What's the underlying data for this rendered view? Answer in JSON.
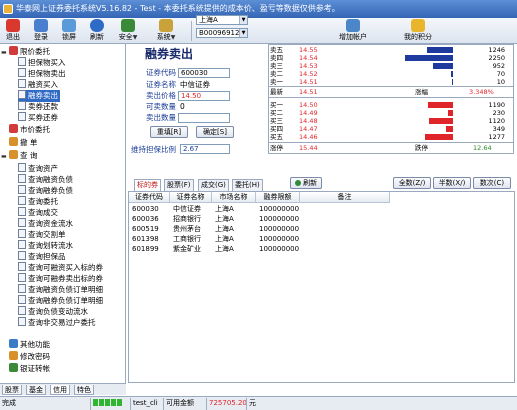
{
  "window": {
    "title": "华泰网上证券委托系统V5.16.82 - Test - 本委托系统提供的成本价、盈亏等数据仅供参考。"
  },
  "toolbar": {
    "items": [
      {
        "label": "退出",
        "icon": "exit-icon"
      },
      {
        "label": "登录",
        "icon": "login-icon"
      },
      {
        "label": "锁屏",
        "icon": "lock-icon"
      },
      {
        "label": "刷新",
        "icon": "refresh-icon"
      },
      {
        "label": "安全",
        "icon": "security-icon"
      },
      {
        "label": "系统",
        "icon": "system-icon"
      }
    ],
    "market_select": "上海A",
    "account_select": "B00096912",
    "add_account": "增加帐户",
    "my_points": "我的积分"
  },
  "tree": {
    "items": [
      {
        "label": "限价委托",
        "level": 0
      },
      {
        "label": "担保物买入",
        "level": 1
      },
      {
        "label": "担保物卖出",
        "level": 1
      },
      {
        "label": "融资买入",
        "level": 1
      },
      {
        "label": "融券卖出",
        "level": 1,
        "selected": true
      },
      {
        "label": "卖券还款",
        "level": 1
      },
      {
        "label": "买券还券",
        "level": 1
      },
      {
        "label": "市价委托",
        "level": 0
      },
      {
        "label": "撤    单",
        "level": 0
      },
      {
        "label": "查    询",
        "level": 0
      },
      {
        "label": "查询资产",
        "level": 2
      },
      {
        "label": "查询融资负债",
        "level": 2
      },
      {
        "label": "查询融券负债",
        "level": 2
      },
      {
        "label": "查询委托",
        "level": 2
      },
      {
        "label": "查询成交",
        "level": 2
      },
      {
        "label": "查询资金流水",
        "level": 2
      },
      {
        "label": "查询交割单",
        "level": 2
      },
      {
        "label": "查询划转流水",
        "level": 2
      },
      {
        "label": "查询担保品",
        "level": 2
      },
      {
        "label": "查询可融资买入标的券",
        "level": 2
      },
      {
        "label": "查询可融券卖出标的券",
        "level": 2
      },
      {
        "label": "查询融资负债订单明细",
        "level": 2
      },
      {
        "label": "查询融券负债订单明细",
        "level": 2
      },
      {
        "label": "查询负债变动流水",
        "level": 2
      },
      {
        "label": "查询非交易过户委托",
        "level": 2
      },
      {
        "label": "其他功能",
        "level": 0
      },
      {
        "label": "修改密码",
        "level": 0
      },
      {
        "label": "银证转帐",
        "level": 0
      }
    ],
    "tabs": [
      "股票",
      "基金",
      "信用",
      "特色"
    ]
  },
  "form": {
    "title": "融券卖出",
    "code_label": "证券代码",
    "code_value": "600030",
    "name_label": "证券名称",
    "name_value": "中信证券",
    "price_label": "卖出价格",
    "price_value": "14.50",
    "avail_label": "可卖数量",
    "avail_value": "0",
    "qty_label": "卖出数量",
    "qty_value": "",
    "reset_button": "重填[R]",
    "confirm_button": "确定[S]",
    "ratio_label": "维持担保比例",
    "ratio_value": "2.67"
  },
  "quote": {
    "sells": [
      {
        "label": "卖五",
        "price": "14.55",
        "vol": "1246",
        "bar": 0.22
      },
      {
        "label": "卖四",
        "price": "14.54",
        "vol": "2250",
        "bar": 0.4
      },
      {
        "label": "卖三",
        "price": "14.53",
        "vol": "952",
        "bar": 0.17
      },
      {
        "label": "卖二",
        "price": "14.52",
        "vol": "70",
        "bar": 0.02
      },
      {
        "label": "卖一",
        "price": "14.51",
        "vol": "10",
        "bar": 0.01
      }
    ],
    "latest_label": "最新",
    "latest_value": "14.51",
    "change_label": "涨幅",
    "change_value": "3.348%",
    "buys": [
      {
        "label": "买一",
        "price": "14.50",
        "vol": "1190",
        "bar": 0.21
      },
      {
        "label": "买二",
        "price": "14.49",
        "vol": "230",
        "bar": 0.04
      },
      {
        "label": "买三",
        "price": "14.48",
        "vol": "1120",
        "bar": 0.2
      },
      {
        "label": "买四",
        "price": "14.47",
        "vol": "349",
        "bar": 0.06
      },
      {
        "label": "买五",
        "price": "14.46",
        "vol": "1277",
        "bar": 0.23
      }
    ],
    "limit_up_label": "涨停",
    "limit_up_value": "15.44",
    "limit_down_label": "跌停",
    "limit_down_value": "12.64",
    "colors": {
      "sell_bar": "#1e3a9e",
      "buy_bar": "#e0252a"
    }
  },
  "grid": {
    "tabs": [
      "标的券",
      "股票(F)",
      "成交(G)",
      "委托(H)"
    ],
    "refresh_button": "刷新",
    "all_button": "全数(Z/)",
    "half_button": "半数(X/)",
    "count_button": "数次(C)",
    "headers": [
      "证券代码",
      "证券名称",
      "市场名称",
      "融券限额",
      "备注"
    ],
    "rows": [
      [
        "600030",
        "中信证券",
        "上海A",
        "100000000",
        ""
      ],
      [
        "600036",
        "招商银行",
        "上海A",
        "100000000",
        ""
      ],
      [
        "600519",
        "贵州茅台",
        "上海A",
        "100000000",
        ""
      ],
      [
        "601398",
        "工商银行",
        "上海A",
        "100000000",
        ""
      ],
      [
        "601899",
        "紫金矿业",
        "上海A",
        "100000000",
        ""
      ]
    ]
  },
  "status": {
    "text": "完成",
    "user": "test_cli",
    "funds_label": "可用金额",
    "funds_value": "725705.20",
    "unit": "元"
  }
}
